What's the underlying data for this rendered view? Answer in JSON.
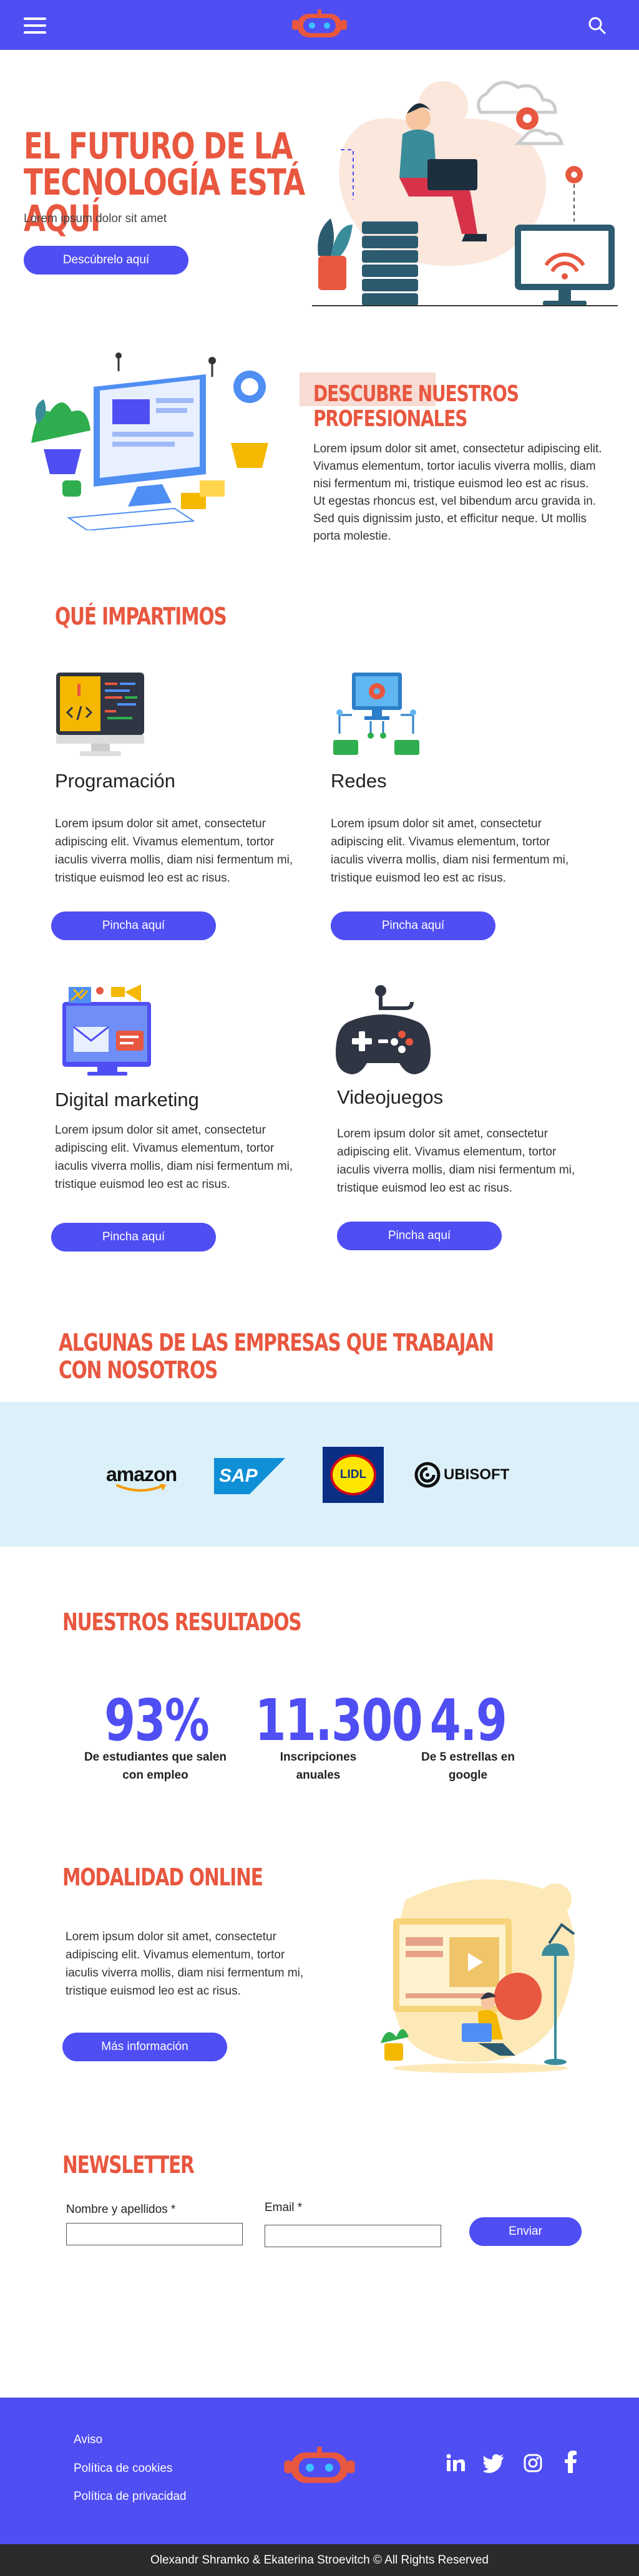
{
  "header": {
    "menu_icon": "hamburger-menu-icon",
    "logo_icon": "robot-face-logo",
    "search_icon": "search-icon"
  },
  "hero": {
    "title_line1": "El futuro de la",
    "title_line2": "tecnología está aquí",
    "subtitle": "Lorem ipsum dolor sit amet",
    "button": "Descúbrelo aquí"
  },
  "professionals": {
    "title_line1": "Descubre nuestros",
    "title_line2": "profesionales",
    "text": "Lorem ipsum dolor sit amet, consectetur adipiscing elit. Vivamus elementum, tortor iaculis viverra mollis, diam nisi fermentum mi, tristique euismod leo est ac risus. Ut egestas rhoncus est, vel bibendum arcu gravida in. Sed quis dignissim justo, et efficitur neque. Ut mollis porta molestie."
  },
  "courses": {
    "title": "Qué impartimos",
    "items": [
      {
        "title": "Programación",
        "text": "Lorem ipsum dolor sit amet, consectetur adipiscing elit. Vivamus elementum, tortor iaculis viverra mollis, diam nisi fermentum mi, tristique euismod leo est ac risus.",
        "button": "Pincha aquí",
        "icon": "monitor-code-icon"
      },
      {
        "title": "Redes",
        "text": "Lorem ipsum dolor sit amet, consectetur adipiscing elit. Vivamus elementum, tortor iaculis viverra mollis, diam nisi fermentum mi, tristique euismod leo est ac risus.",
        "button": "Pincha aquí",
        "icon": "network-monitor-icon"
      },
      {
        "title": "Digital marketing",
        "text": "Lorem ipsum dolor sit amet, consectetur adipiscing elit. Vivamus elementum, tortor iaculis viverra mollis, diam nisi fermentum mi, tristique euismod leo est ac risus.",
        "button": "Pincha aquí",
        "icon": "marketing-screen-icon"
      },
      {
        "title": "Videojuegos",
        "text": "Lorem ipsum dolor sit amet, consectetur adipiscing elit. Vivamus elementum, tortor iaculis viverra mollis, diam nisi fermentum mi, tristique euismod leo est ac risus.",
        "button": "Pincha aquí",
        "icon": "gamepad-icon"
      }
    ]
  },
  "companies": {
    "title": "Algunas de las empresas que trabajan con nosotros",
    "logos": [
      {
        "name": "amazon",
        "icon": "amazon-logo"
      },
      {
        "name": "SAP",
        "icon": "sap-logo"
      },
      {
        "name": "LIDL",
        "icon": "lidl-logo"
      },
      {
        "name": "UBISOFT",
        "icon": "ubisoft-logo"
      }
    ]
  },
  "results": {
    "title": "Nuestros resultados",
    "stats": [
      {
        "value": "93%",
        "label_line1": "De estudiantes que salen",
        "label_line2": "con empleo"
      },
      {
        "value": "11.300",
        "label_line1": "Inscripciones",
        "label_line2": "anuales"
      },
      {
        "value": "4.9",
        "label_line1": "De 5 estrellas en",
        "label_line2": "google"
      }
    ]
  },
  "online": {
    "title": "Modalidad online",
    "text": "Lorem ipsum dolor sit amet, consectetur adipiscing elit. Vivamus elementum, tortor iaculis viverra mollis, diam nisi fermentum mi, tristique euismod leo est ac risus.",
    "button": "Más información"
  },
  "newsletter": {
    "title": "Newsletter",
    "name_label": "Nombre y apellidos *",
    "name_value": "",
    "email_label": "Email *",
    "email_value": "",
    "button": "Enviar"
  },
  "footer": {
    "links": [
      "Aviso",
      "Política de cookies",
      "Política de privacidad"
    ],
    "social": [
      "linkedin-icon",
      "twitter-icon",
      "instagram-icon",
      "facebook-icon"
    ],
    "copyright": "Olexandr Shramko & Ekaterina Stroevitch © All Rights Reserved"
  },
  "colors": {
    "primary": "#4f4ef3",
    "accent": "#e8573f",
    "band": "#dcf0fa",
    "footer_bottom": "#2b2b2b"
  }
}
